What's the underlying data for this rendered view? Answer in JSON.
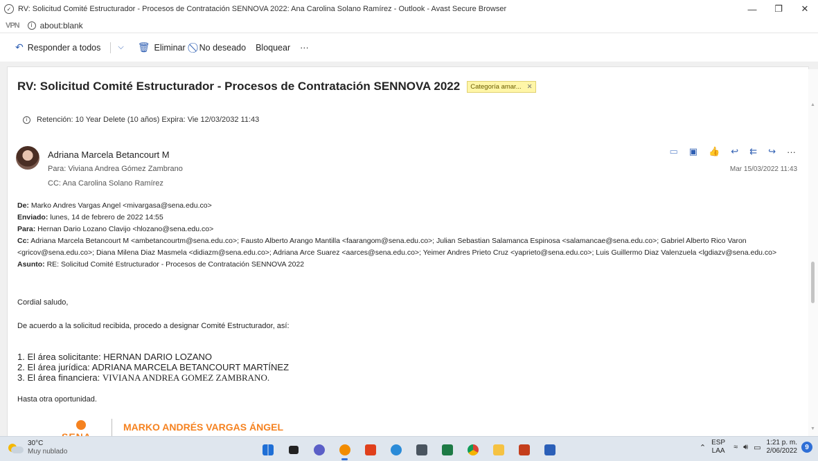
{
  "window": {
    "title": "RV: Solicitud Comité Estructurador - Procesos de Contratación SENNOVA 2022: Ana Carolina Solano Ramírez - Outlook - Avast Secure Browser",
    "minimize": "—",
    "maximize": "❐",
    "close": "✕"
  },
  "address": {
    "vpn": "VPN",
    "url": "about:blank"
  },
  "toolbar": {
    "reply_all": "Responder a todos",
    "delete": "Eliminar",
    "junk": "No deseado",
    "block": "Bloquear",
    "more": "···"
  },
  "email": {
    "subject": "RV: Solicitud Comité Estructurador - Procesos de Contratación SENNOVA 2022",
    "category": "Categoría amar...",
    "retention": "Retención: 10 Year Delete (10 años) Expira: Vie 12/03/2032 11:43",
    "sender": "Adriana Marcela Betancourt M",
    "to": "Para: Viviana Andrea Gómez Zambrano",
    "cc": "CC: Ana Carolina Solano Ramírez",
    "date": "Mar 15/03/2022 11:43",
    "fwd": {
      "de_label": "De:",
      "de": " Marko Andres Vargas Angel <mivargasa@sena.edu.co>",
      "enviado_label": "Enviado:",
      "enviado": " lunes, 14 de febrero de 2022 14:55",
      "para_label": "Para:",
      "para": " Hernan Dario Lozano Clavijo <hlozano@sena.edu.co>",
      "cc_label": "Cc:",
      "cc": " Adriana Marcela Betancourt M <ambetancourtm@sena.edu.co>; Fausto Alberto Arango Mantilla <faarangom@sena.edu.co>; Julian Sebastian Salamanca Espinosa <salamancae@sena.edu.co>; Gabriel Alberto Rico Varon <gricov@sena.edu.co>; Diana Milena Diaz Masmela <didiazm@sena.edu.co>; Adriana Arce Suarez <aarces@sena.edu.co>; Yeimer Andres Prieto Cruz <yaprieto@sena.edu.co>; Luis Guillermo Diaz Valenzuela <lgdiazv@sena.edu.co>",
      "asunto_label": "Asunto:",
      "asunto": " RE: Solicitud Comité Estructurador - Procesos de Contratación SENNOVA 2022"
    },
    "greeting": "Cordial saludo,",
    "intro": "De acuerdo a la solicitud recibida, procedo a designar Comité Estructurador, así:",
    "list": [
      "1. El área solicitante: HERNAN DARIO LOZANO",
      "2. El área jurídica: ADRIANA MARCELA BETANCOURT MARTÍNEZ",
      "3. El área financiera: "
    ],
    "list3_value": "VIVIANA ANDREA GOMEZ ZAMBRANO.",
    "closing": "Hasta otra oportunidad.",
    "sig_logo": "SENA",
    "sig_name": "MARKO ANDRÉS VARGAS ÁNGEL"
  },
  "taskbar": {
    "temp": "30°C",
    "weather": "Muy nublado",
    "lang1": "ESP",
    "lang2": "LAA",
    "time": "1:21 p. m.",
    "date": "2/06/2022",
    "notif": "9"
  },
  "colors": {
    "accent": "#2f5fb3",
    "sena_orange": "#f58220",
    "category": "#fff6a8"
  }
}
